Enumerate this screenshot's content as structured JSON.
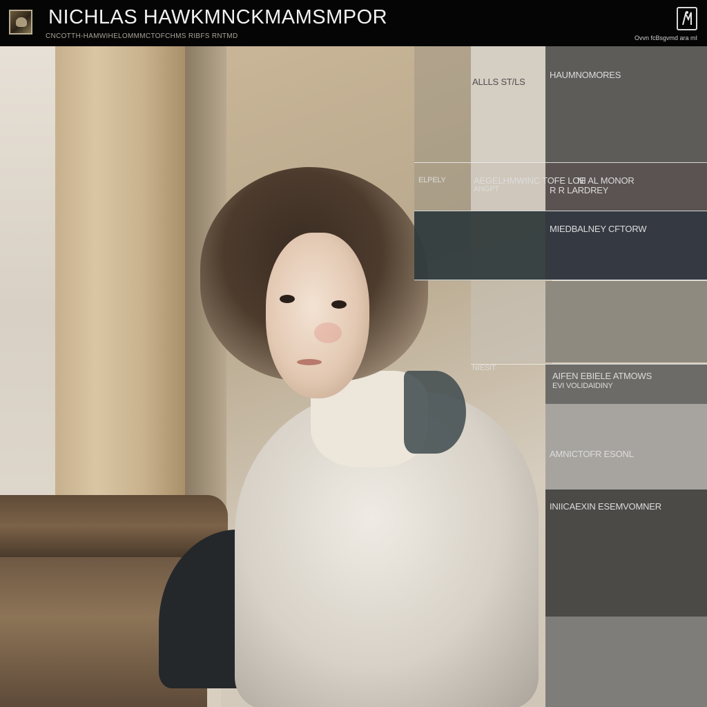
{
  "header": {
    "title": "NICHLAS HAWKMNCKMAMSMPOR",
    "subtitle": "CNCOTTH-HAMWIHELOMMMCTOFCHMS  RIBFS  RNTMD",
    "right_text": "Ovvn fcBsgvmd ara mI"
  },
  "colors": {
    "header_bg": "#050505",
    "swatch_1": "#d5cec3",
    "swatch_2": "#5e5c59",
    "swatch_3": "#2f3a3c",
    "swatch_4": "#353a42",
    "swatch_5": "#8f8a80",
    "swatch_6": "#6c6b68",
    "swatch_7": "#a7a49f",
    "swatch_8": "#4b4a47",
    "swatch_9": "#7f7d7a"
  },
  "palette": {
    "labels": [
      "ALLLS  ST/LS",
      "HAUMNOMORES",
      "ELPELY",
      "AEGELHMWINC TOFE  LOE",
      "ANGPT",
      "R  R  LARDREY",
      "NI AL MONOR",
      "MIEDBALNEY CFTORW",
      "NIESIT",
      "AIFEN  EBIELE ATMOWS",
      "EVI  VOLIDAIDINY",
      "AMNICTOFR ESONL",
      "INIICAEXIN  ESEMVOMNER"
    ]
  }
}
